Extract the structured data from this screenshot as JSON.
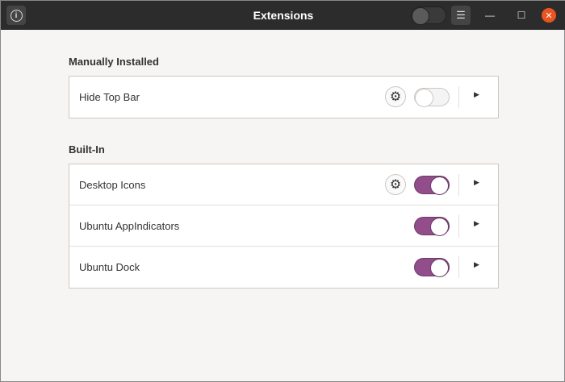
{
  "header": {
    "title": "Extensions",
    "global_toggle": false
  },
  "sections": [
    {
      "title": "Manually Installed",
      "items": [
        {
          "name": "Hide Top Bar",
          "settings": true,
          "enabled": false
        }
      ]
    },
    {
      "title": "Built-In",
      "items": [
        {
          "name": "Desktop Icons",
          "settings": true,
          "enabled": true
        },
        {
          "name": "Ubuntu AppIndicators",
          "settings": false,
          "enabled": true
        },
        {
          "name": "Ubuntu Dock",
          "settings": false,
          "enabled": true
        }
      ]
    }
  ],
  "colors": {
    "accent": "#924d8b",
    "close": "#e95420"
  }
}
